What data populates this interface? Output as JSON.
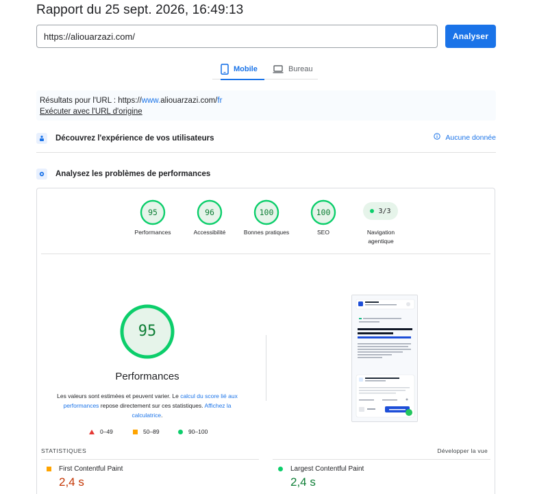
{
  "header": {
    "title": "Rapport du 25 sept. 2026, 16:49:13"
  },
  "search": {
    "url_value": "https://aliouarzazi.com/",
    "analyze_label": "Analyser"
  },
  "tabs": [
    {
      "label": "Mobile",
      "active": true
    },
    {
      "label": "Bureau",
      "active": false
    }
  ],
  "results": {
    "prefix": "Résultats pour l'URL : ",
    "url_part1": "https://",
    "url_part2": "www.",
    "url_part3": "aliouarzazi.com/",
    "url_part4": "fr",
    "origin_link": "Exécuter avec l'URL d'origine"
  },
  "sections": {
    "experience_title": "Découvrez l'expérience de vos utilisateurs",
    "no_data": "Aucune donnée",
    "performance_title": "Analysez les problèmes de performances"
  },
  "scores": [
    {
      "label": "Performances",
      "value": "95"
    },
    {
      "label": "Accessibilité",
      "value": "96"
    },
    {
      "label": "Bonnes pratiques",
      "value": "100"
    },
    {
      "label": "SEO",
      "value": "100"
    }
  ],
  "agentic": {
    "value": "3/3",
    "label_line1": "Navigation",
    "label_line2": "agentique"
  },
  "main_score": {
    "value": "95",
    "title": "Performances",
    "text_1": "Les valeurs sont estimées et peuvent varier. Le ",
    "link_1": "calcul du score lié aux performances",
    "text_2": " repose directement sur ces statistiques. ",
    "link_2": "Affichez la calculatrice",
    "text_3": "."
  },
  "legend": {
    "fail": "0–49",
    "average": "50–89",
    "pass": "90–100"
  },
  "stats": {
    "label": "STATISTIQUES",
    "expand": "Développer la vue",
    "metrics": [
      {
        "name": "First Contentful Paint",
        "value": "2,4 s"
      },
      {
        "name": "Largest Contentful Paint",
        "value": "2,4 s"
      }
    ]
  },
  "colors": {
    "accent": "#1a73e8",
    "pass": "#0cce6b",
    "pass_text": "#0c7d34",
    "average": "#ffa400",
    "fail": "#e53935",
    "fcp_value": "#c33300"
  }
}
